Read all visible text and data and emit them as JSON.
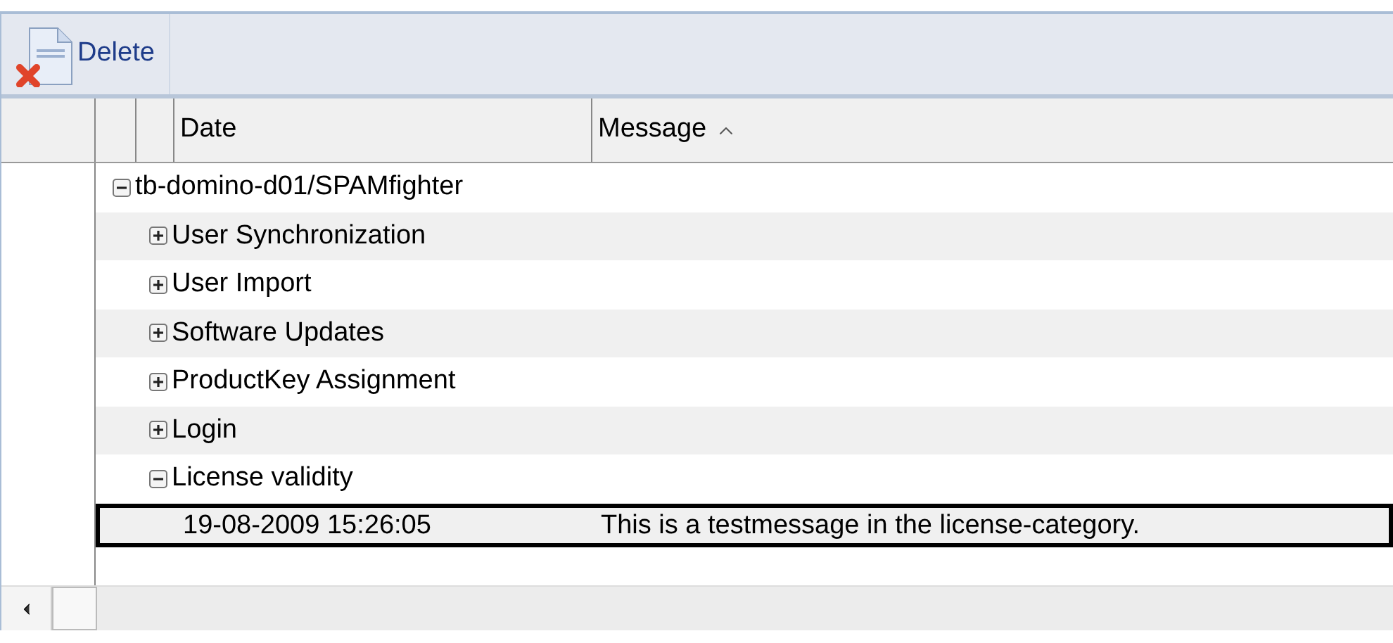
{
  "toolbar": {
    "buttons": [
      {
        "label": "Delete"
      }
    ]
  },
  "table": {
    "columns": [
      {
        "label": "Date",
        "sorted": false
      },
      {
        "label": "Message",
        "sorted": true
      }
    ],
    "tree": [
      {
        "label": "tb-domino-d01/SPAMfighter",
        "expanded": true,
        "children": [
          {
            "label": "User Synchronization",
            "expanded": false
          },
          {
            "label": "User Import",
            "expanded": false
          },
          {
            "label": "Software Updates",
            "expanded": false
          },
          {
            "label": "ProductKey Assignment",
            "expanded": false
          },
          {
            "label": "Login",
            "expanded": false
          },
          {
            "label": "License validity",
            "expanded": true,
            "entries": [
              {
                "date": "19-08-2009 15:26:05",
                "message": "This is a testmessage in the license-category.",
                "selected": true
              }
            ]
          }
        ]
      }
    ]
  }
}
